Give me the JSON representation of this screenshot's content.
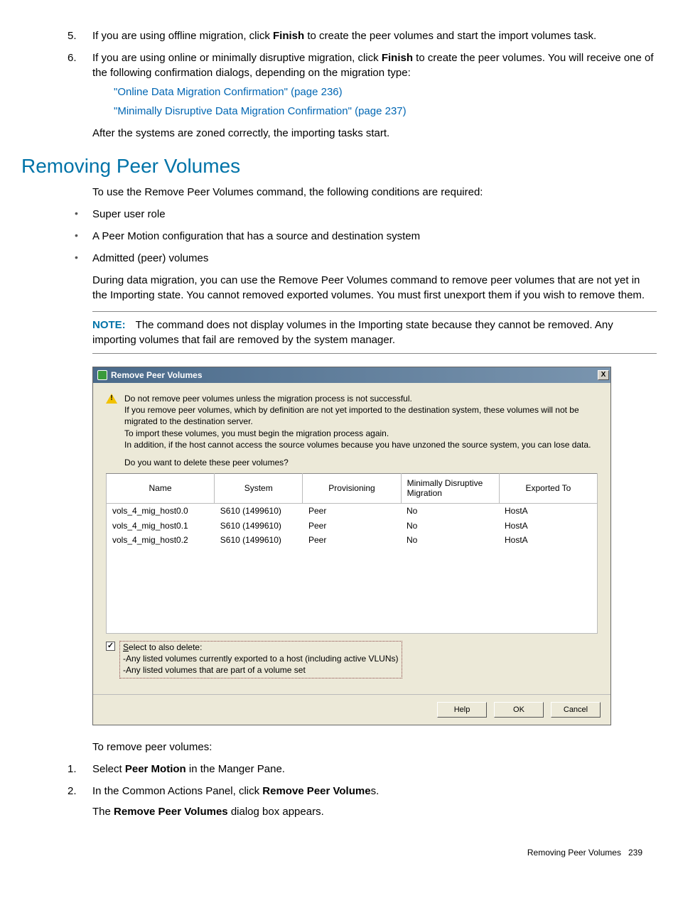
{
  "list1": {
    "item5_a": "If you are using offline migration, click ",
    "item5_b": "Finish",
    "item5_c": " to create the peer volumes and start the import volumes task.",
    "item6_a": "If you are using online or minimally disruptive migration, click ",
    "item6_b": "Finish",
    "item6_c": " to create the peer volumes. You will receive one of the following confirmation dialogs, depending on the migration type:",
    "link1": "\"Online Data Migration Confirmation\" (page 236)",
    "link2": "\"Minimally Disruptive Data Migration Confirmation\" (page 237)"
  },
  "after_zoned": "After the systems are zoned correctly, the importing tasks start.",
  "section_title": "Removing Peer Volumes",
  "intro": "To use the Remove Peer Volumes command, the following conditions are required:",
  "reqs": {
    "r1": "Super user role",
    "r2": "A Peer Motion configuration that has a source and destination system",
    "r3": "Admitted (peer) volumes"
  },
  "during": "During data migration, you can use the Remove Peer Volumes command to remove peer volumes that are not yet in the Importing state. You cannot removed exported volumes. You must first unexport them if you wish to remove them.",
  "note": {
    "label": "NOTE:",
    "text": "The command does not display volumes in the Importing state because they cannot be removed. Any importing volumes that fail are removed by the system manager."
  },
  "dialog": {
    "title": "Remove Peer Volumes",
    "close": "X",
    "warn1": "Do not remove peer volumes unless the migration process is not successful.",
    "warn2": "If you remove peer volumes, which by definition are not yet imported to the destination system, these volumes will not be migrated to the destination server.",
    "warn3": "To import these volumes, you must begin the migration process again.",
    "warn4": "In addition, if the host cannot access the source volumes because you have unzoned the source system, you can lose data.",
    "question": "Do you want to delete these peer volumes?",
    "headers": {
      "name": "Name",
      "system": "System",
      "prov": "Provisioning",
      "mdm": "Minimally Disruptive Migration",
      "exp": "Exported To"
    },
    "rows": [
      {
        "name": "vols_4_mig_host0.0",
        "system": "S610 (1499610)",
        "prov": "Peer",
        "mdm": "No",
        "exp": "HostA"
      },
      {
        "name": "vols_4_mig_host0.1",
        "system": "S610 (1499610)",
        "prov": "Peer",
        "mdm": "No",
        "exp": "HostA"
      },
      {
        "name": "vols_4_mig_host0.2",
        "system": "S610 (1499610)",
        "prov": "Peer",
        "mdm": "No",
        "exp": "HostA"
      }
    ],
    "check_letter": "S",
    "check_rest": "elect to also delete:",
    "check_check": "✓",
    "check_sub1": "Any listed volumes currently exported to a host (including active VLUNs)",
    "check_sub2": "Any listed volumes that are part of a volume set",
    "buttons": {
      "help": "Help",
      "ok": "OK",
      "cancel": "Cancel"
    }
  },
  "post": {
    "intro": "To remove peer volumes:",
    "s1a": "Select ",
    "s1b": "Peer Motion",
    "s1c": " in the Manger Pane.",
    "s2a": "In the Common Actions Panel, click ",
    "s2b": "Remove Peer Volume",
    "s2c": "s.",
    "s2d_a": "The ",
    "s2d_b": "Remove Peer Volumes",
    "s2d_c": " dialog box appears."
  },
  "footer": {
    "text": "Removing Peer Volumes",
    "page": "239"
  }
}
